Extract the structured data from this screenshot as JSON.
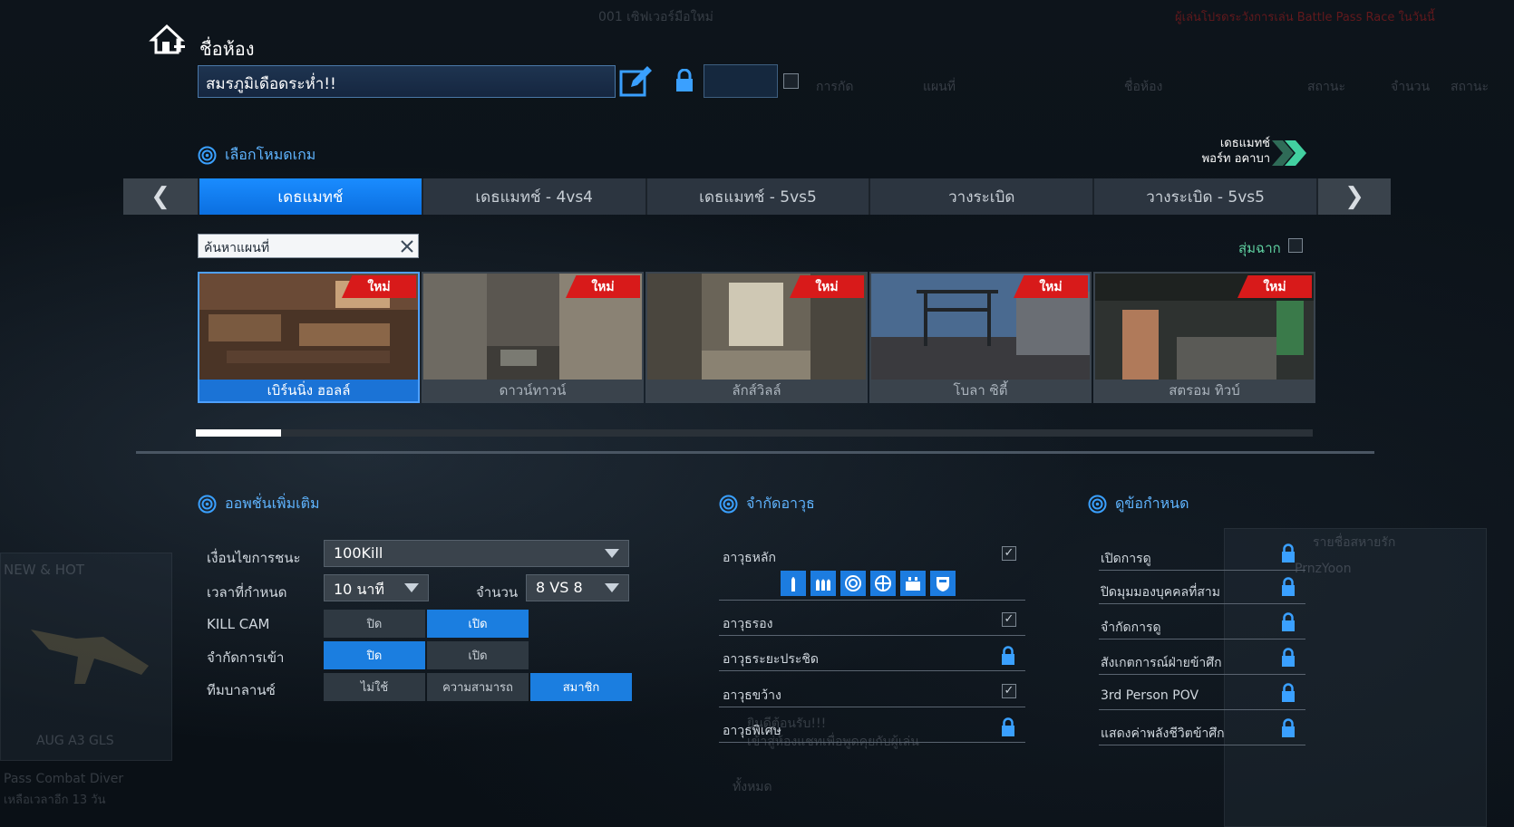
{
  "room": {
    "title": "ชื่อห้อง",
    "name_value": "สมรภูมิเดือดระห่ำ!!"
  },
  "background": {
    "top_center": "001 เซิฟเวอร์มือใหม่",
    "top_right": "ผู้เล่นโปรดระวังการเล่น Battle Pass Race ในวันนี้",
    "col_headers": [
      "การกัด",
      "แผนที่",
      "ชื่อห้อง",
      "สถานะ",
      "จำนวน",
      "สถานะ"
    ],
    "new_hot": "NEW & HOT",
    "weapon_name": "AUG A3 GLS",
    "pass_title": "Pass Combat Diver",
    "pass_sub": "เหลือเวลาอีก 13 วัน",
    "player_name": "PrnzYoon",
    "filter_label": "ทั้งหมด",
    "chat_line1": "ยินดีต้อนรับ!!!",
    "chat_line2": "เข้าสู่ห้องแชทเพื่อพูดคุยกับผู้เล่น",
    "friend_list": "รายชื่อสหายรัก"
  },
  "game_mode": {
    "section_title": "เลือกโหมดเกม",
    "badge_line1": "เดธแมทช์",
    "badge_line2": "พอร์ท อคาบา",
    "prev": "❮",
    "next": "❯",
    "tabs": [
      {
        "label": "เดธแมทช์",
        "active": true
      },
      {
        "label": "เดธแมทช์ - 4vs4",
        "active": false
      },
      {
        "label": "เดธแมทช์ - 5vs5",
        "active": false
      },
      {
        "label": "วางระเบิด",
        "active": false
      },
      {
        "label": "วางระเบิด - 5vs5",
        "active": false
      }
    ]
  },
  "map_search": {
    "placeholder": "ค้นหาแผนที่",
    "random_label": "สุ่มฉาก"
  },
  "maps": [
    {
      "name": "เบิร์นนิ่ง ฮอลล์",
      "badge": "ใหม่",
      "selected": true
    },
    {
      "name": "ดาวน์ทาวน์",
      "badge": "ใหม่",
      "selected": false
    },
    {
      "name": "ลักส์วิลล์",
      "badge": "ใหม่",
      "selected": false
    },
    {
      "name": "โบลา ซิตี้",
      "badge": "ใหม่",
      "selected": false
    },
    {
      "name": "สตรอม ทิวบ์",
      "badge": "ใหม่",
      "selected": false
    }
  ],
  "options": {
    "section_title": "ออพชั่นเพิ่มเติม",
    "win_condition_label": "เงื่อนไขการชนะ",
    "win_condition_value": "100Kill",
    "time_limit_label": "เวลาที่กำหนด",
    "time_limit_value": "10 นาที",
    "count_label": "จำนวน",
    "count_value": "8 VS 8",
    "killcam_label": "KILL CAM",
    "killcam_off": "ปิด",
    "killcam_on": "เปิด",
    "restrict_join_label": "จำกัดการเข้า",
    "restrict_off": "ปิด",
    "restrict_on": "เปิด",
    "team_balance_label": "ทีมบาลานซ์",
    "tb_none": "ไม่ใช้",
    "tb_skill": "ความสามารถ",
    "tb_member": "สมาชิก"
  },
  "weapon_limit": {
    "section_title": "จำกัดอาวุธ",
    "rows": [
      {
        "label": "อาวุธหลัก",
        "state": "checked"
      },
      {
        "label": "อาวุธรอง",
        "state": "checked"
      },
      {
        "label": "อาวุธระยะประชิด",
        "state": "locked"
      },
      {
        "label": "อาวุธขว้าง",
        "state": "checked"
      },
      {
        "label": "อาวุธพิเศษ",
        "state": "locked"
      }
    ],
    "icons": [
      "bullet-icon",
      "ammo-icon",
      "scope-icon",
      "crosshair-icon",
      "armor-icon",
      "shield-icon"
    ]
  },
  "observer": {
    "section_title": "ดูข้อกำหนด",
    "rows": [
      {
        "label": "เปิดการดู"
      },
      {
        "label": "ปิดมุมมองบุคคลที่สาม"
      },
      {
        "label": "จำกัดการดู"
      },
      {
        "label": "สังเกตการณ์ฝ่ายข้าศึก"
      },
      {
        "label": "3rd Person POV"
      },
      {
        "label": "แสดงค่าพลังชีวิตข้าศึก"
      }
    ]
  },
  "colors": {
    "accent": "#1b7ee0",
    "new_badge": "#d81a1a",
    "section_head": "#5fb4ff"
  }
}
